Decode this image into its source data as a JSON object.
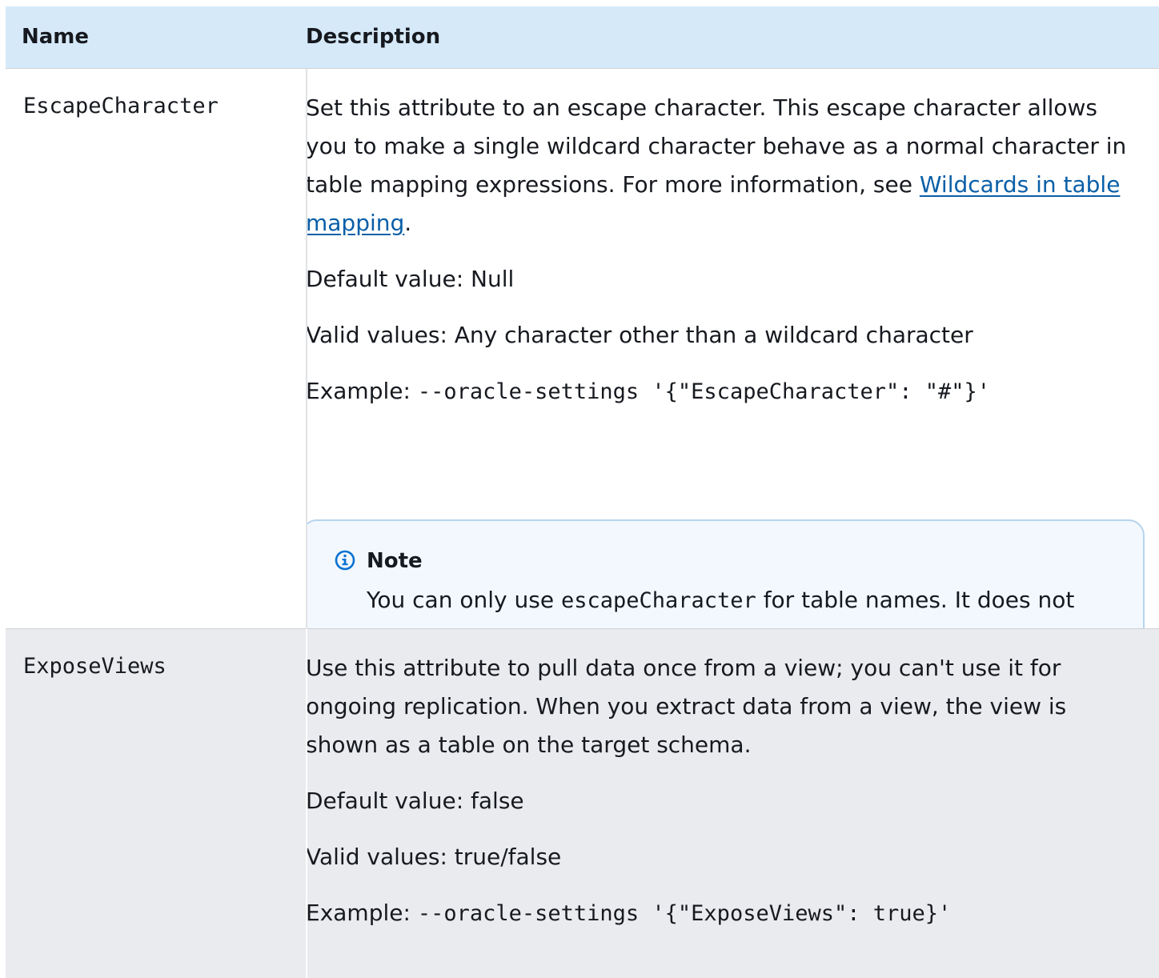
{
  "header": {
    "name_label": "Name",
    "description_label": "Description"
  },
  "rows": [
    {
      "name": "EscapeCharacter",
      "desc_p1_before": "Set this attribute to an escape character. This escape character allows you to make a single wildcard character behave as a normal character in table mapping expressions. For more information, see ",
      "desc_p1_link": "Wildcards in table mapping",
      "desc_p1_after": ".",
      "default_value": "Default value: Null",
      "valid_values": "Valid values: Any character other than a wildcard character",
      "example_prefix": "Example: ",
      "example_code": "--oracle-settings '{\"EscapeCharacter\": \"#\"}'",
      "note": {
        "title": "Note",
        "body_before": "You can only use ",
        "body_code": "escapeCharacter",
        "body_after": "  for table names. It does not escape characters from schema names or column names."
      }
    },
    {
      "name": "ExposeViews",
      "desc_p1": "Use this attribute to pull data once from a view; you can't use it for ongoing replication. When you extract data from a view, the view is shown as a table on the target schema.",
      "default_value": "Default value: false",
      "valid_values": "Valid values: true/false",
      "example_prefix": "Example: ",
      "example_code": "--oracle-settings '{\"ExposeViews\": true}'"
    }
  ],
  "colors": {
    "header_bg": "#d6e9f8",
    "row_alt_bg": "#eaebee",
    "link": "#0a5fa8",
    "note_bg": "#f2f8fd",
    "note_border": "#b6d4ee",
    "info_icon": "#0972d3"
  },
  "icons": {
    "note_icon": "info-circle-icon"
  }
}
